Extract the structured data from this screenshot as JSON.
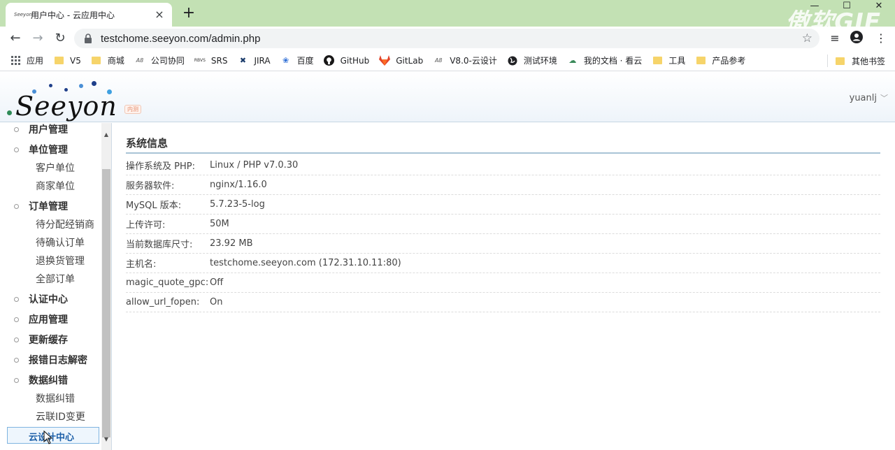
{
  "browser": {
    "tab_title": "用户中心 - 云应用中心",
    "tab_favicon_text": "Seeyon",
    "url": "testchome.seeyon.com/admin.php",
    "watermark": "傲软GIF",
    "bookmarks": [
      {
        "label": "应用",
        "icon": "apps-grid-icon"
      },
      {
        "label": "V5",
        "icon": "folder-icon"
      },
      {
        "label": "商城",
        "icon": "folder-icon"
      },
      {
        "label": "公司协同",
        "icon": "a8-icon"
      },
      {
        "label": "SRS",
        "icon": "srs-icon"
      },
      {
        "label": "JIRA",
        "icon": "jira-icon"
      },
      {
        "label": "百度",
        "icon": "baidu-paw-icon"
      },
      {
        "label": "GitHub",
        "icon": "github-icon"
      },
      {
        "label": "GitLab",
        "icon": "gitlab-icon"
      },
      {
        "label": "V8.0-云设计",
        "icon": "a8-icon"
      },
      {
        "label": "测试环境",
        "icon": "globe-icon"
      },
      {
        "label": "我的文档 · 看云",
        "icon": "cloud-doc-icon"
      },
      {
        "label": "工具",
        "icon": "folder-icon"
      },
      {
        "label": "产品参考",
        "icon": "folder-icon"
      }
    ],
    "other_bookmarks": "其他书签"
  },
  "header": {
    "logo_text": "Seeyon",
    "logo_badge": "内测",
    "user": "yuanlj"
  },
  "sidebar": {
    "partial_top": "用户管理",
    "groups": [
      {
        "label": "单位管理",
        "items": [
          "客户单位",
          "商家单位"
        ]
      },
      {
        "label": "订单管理",
        "items": [
          "待分配经销商",
          "待确认订单",
          "退换货管理",
          "全部订单"
        ]
      },
      {
        "label": "认证中心",
        "items": []
      },
      {
        "label": "应用管理",
        "items": []
      },
      {
        "label": "更新缓存",
        "items": []
      },
      {
        "label": "报错日志解密",
        "items": []
      },
      {
        "label": "数据纠错",
        "items": [
          "数据纠错",
          "云联ID变更"
        ]
      }
    ],
    "active": "云设计中心"
  },
  "main": {
    "title": "系统信息",
    "rows": [
      {
        "label": "操作系统及 PHP:",
        "value": "Linux / PHP v7.0.30"
      },
      {
        "label": "服务器软件:",
        "value": "nginx/1.16.0"
      },
      {
        "label": "MySQL 版本:",
        "value": "5.7.23-5-log"
      },
      {
        "label": "上传许可:",
        "value": "50M"
      },
      {
        "label": "当前数据库尺寸:",
        "value": "23.92 MB"
      },
      {
        "label": "主机名:",
        "value": "testchome.seeyon.com (172.31.10.11:80)"
      },
      {
        "label": "magic_quote_gpc:",
        "value": "Off"
      },
      {
        "label": "allow_url_fopen:",
        "value": "On"
      }
    ]
  }
}
